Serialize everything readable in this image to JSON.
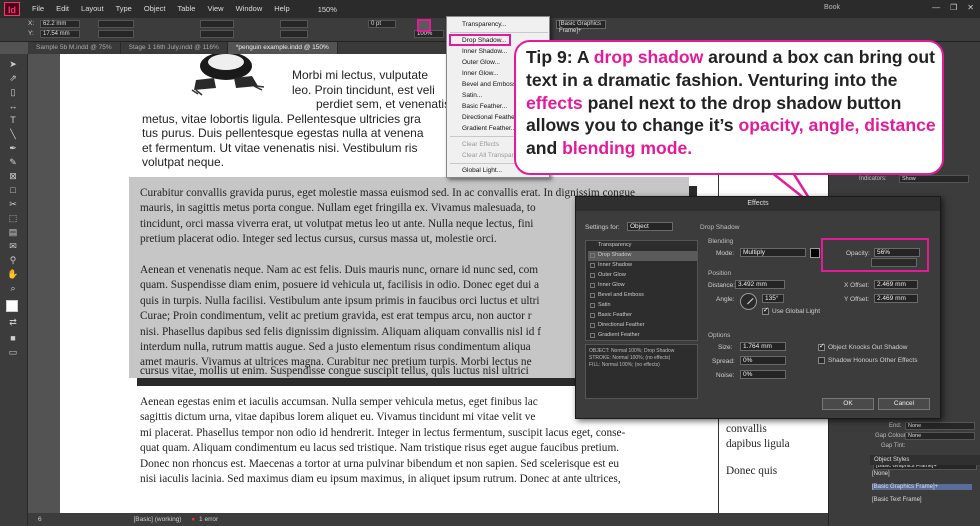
{
  "app": {
    "icon": "Id"
  },
  "menu": [
    "File",
    "Edit",
    "Layout",
    "Type",
    "Object",
    "Table",
    "View",
    "Window",
    "Help"
  ],
  "zoom": "150%",
  "book": "Book",
  "window_controls": [
    "—",
    "❐",
    "✕"
  ],
  "control_bar": {
    "x": "62.2 mm",
    "y": "17.54 mm",
    "stroke_weight": "0 pt",
    "opacity": "100%",
    "frame_style": "[Basic Graphics Frame]+"
  },
  "doc_tabs": [
    {
      "label": "Sample 5b M.indd @ 75%",
      "active": false
    },
    {
      "label": "Stage 1 16th July.indd @ 116%",
      "active": false
    },
    {
      "label": "*penguin example.indd @ 150%",
      "active": true
    }
  ],
  "fx_menu": {
    "items": [
      {
        "label": "Transparency...",
        "disabled": false
      },
      {
        "label": "Drop Shadow...",
        "disabled": false
      },
      {
        "label": "Inner Shadow...",
        "disabled": false
      },
      {
        "label": "Outer Glow...",
        "disabled": false
      },
      {
        "label": "Inner Glow...",
        "disabled": false
      },
      {
        "label": "Bevel and Emboss...",
        "disabled": false
      },
      {
        "label": "Satin...",
        "disabled": false
      },
      {
        "label": "Basic Feather...",
        "disabled": false
      },
      {
        "label": "Directional Feather...",
        "disabled": false
      },
      {
        "label": "Gradient Feather...",
        "disabled": false
      },
      {
        "label": "Clear Effects",
        "disabled": true
      },
      {
        "label": "Clear All Transparency",
        "disabled": true
      },
      {
        "label": "Global Light...",
        "disabled": false
      }
    ]
  },
  "tip": {
    "prefix": "Tip 9: A ",
    "hl1": "drop shadow",
    "mid1": " around a box can bring out text in a dramatic fashion. Venturing into the ",
    "hl2": "effects",
    "mid2": " panel next to the drop shadow button allows you to change it’s ",
    "hl3": "opacity, angle, distance",
    "mid3": " and ",
    "hl4": "blending mode."
  },
  "document": {
    "top_lines": [
      "Morbi mi lectus, vulputate",
      "leo. Proin tincidunt, est veli",
      "perdiet sem, et venenatis t"
    ],
    "sans_lines": [
      "metus, vitae lobortis ligula. Pellentesque ultricies gra",
      "tus purus. Duis pellentesque egestas nulla at venena",
      "et fermentum. Ut vitae venenatis nisi. Vestibulum ris",
      "volutpat neque."
    ],
    "box_lines": [
      "Curabitur convallis gravida purus, eget molestie massa euismod sed. In ac convallis erat. In dignissim congue",
      "mauris, in sagittis metus porta congue. Nullam eget fringilla ex. Vivamus malesuada, to",
      "tincidunt, orci massa viverra erat, ut volutpat metus leo ut ante. Nulla neque lectus, fini",
      "pretium placerat odio. Integer sed lectus cursus, cursus massa ut, molestie orci.",
      "",
      "Aenean et venenatis neque. Nam ac est felis. Duis mauris nunc, ornare id nunc sed, com",
      "quam. Suspendisse diam enim, posuere id vehicula ut, facilisis in odio. Donec eget dui a",
      "quis in turpis. Nulla facilisi. Vestibulum ante ipsum primis in faucibus orci luctus et ultri",
      "Curae; Proin condimentum, velit ac pretium gravida, est erat tempus arcu, non auctor r",
      "nisi. Phasellus dapibus sed felis dignissim dignissim. Aliquam aliquam convallis nisl id f",
      "interdum nulla, rutrum mattis augue. Sed a justo elementum risus condimentum aliqua",
      "amet mauris. Vivamus at ultrices magna. Curabitur nec pretium turpis. Morbi lectus ne",
      "cursus vitae, mollis ut enim. Suspendisse congue suscipit tellus, quis luctus nisl ultrici"
    ],
    "bottom_lines": [
      "Aenean egestas enim et iaculis accumsan. Nulla semper vehicula metus, eget finibus lac",
      "sagittis dictum urna, vitae dapibus lorem aliquet eu. Vivamus tincidunt mi vitae velit ve",
      "mi placerat. Phasellus tempor non odio id hendrerit. Integer in lectus fermentum, suscipit lacus eget, conse-",
      "quat quam. Aliquam condimentum eu lacus sed tristique. Nam tristique risus eget augue faucibus pretium.",
      "Donec non rhoncus est. Maecenas a tortor at urna pulvinar bibendum et non sapien. Sed scelerisque est eu",
      "nisi iaculis lacinia. Sed maximus diam eu ipsum maximus, in aliquet ipsum rutrum. Donec at ante ultrices,"
    ],
    "right_lines": [
      "convallis",
      "dapibus ligula",
      "",
      "Donec quis"
    ]
  },
  "effects_dialog": {
    "title": "Effects",
    "settings_for_label": "Settings for:",
    "settings_for_value": "Object",
    "transparency_label": "Transparency",
    "effects_list": [
      "Drop Shadow",
      "Inner Shadow",
      "Outer Glow",
      "Inner Glow",
      "Bevel and Emboss",
      "Satin",
      "Basic Feather",
      "Directional Feather",
      "Gradient Feather"
    ],
    "summary": [
      "OBJECT: Normal 100%; Drop Shadow",
      "STROKE: Normal 100%; (no effects)",
      "FILL: Normal 100%; (no effects)"
    ],
    "section_title": "Drop Shadow",
    "blending": {
      "label": "Blending",
      "mode_label": "Mode:",
      "mode": "Multiply",
      "opacity_label": "Opacity:",
      "opacity": "56%"
    },
    "position": {
      "label": "Position",
      "distance_label": "Distance:",
      "distance": "3.492 mm",
      "angle_label": "Angle:",
      "angle": "135°",
      "global_light": "Use Global Light",
      "x_label": "X Offset:",
      "x": "2.469 mm",
      "y_label": "Y Offset:",
      "y": "2.469 mm"
    },
    "options": {
      "label": "Options",
      "size_label": "Size:",
      "size": "1.764 mm",
      "spread_label": "Spread:",
      "spread": "0%",
      "noise_label": "Noise:",
      "noise": "0%",
      "knocks_out": "Object Knocks Out Shadow",
      "honours": "Shadow Honours Other Effects"
    },
    "ok": "OK",
    "cancel": "Cancel"
  },
  "panels": {
    "indicators_label": "Indicators:",
    "indicators_value": "Show",
    "end_label": "End:",
    "end_value": "None",
    "gap_colour_label": "Gap Colour:",
    "gap_colour_value": "None",
    "gap_tint_label": "Gap Tint:",
    "object_styles_title": "Object Styles",
    "object_style_current": "[Basic Graphics Frame]+",
    "object_styles": [
      "[None]",
      "[Basic Graphics Frame]+",
      "[Basic Text Frame]"
    ]
  },
  "status": {
    "page": "6",
    "preflight": "[Basic] (working)",
    "errors": "1 error"
  }
}
